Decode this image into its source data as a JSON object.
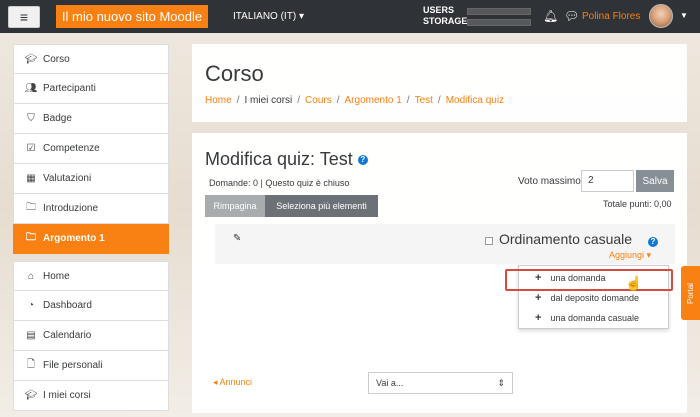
{
  "navbar": {
    "menu_icon": "hamburger-icon",
    "site_name": "Il mio nuovo sito Moodle",
    "language": "ITALIANO (IT)",
    "usage_labels": [
      "USERS",
      "STORAGE"
    ],
    "user_name": "Polina Flores",
    "accent_color": "#f98012"
  },
  "sidebar": {
    "items": [
      {
        "label": "Corso",
        "icon": "graduation-cap-icon"
      },
      {
        "label": "Partecipanti",
        "icon": "users-icon"
      },
      {
        "label": "Badge",
        "icon": "shield-icon"
      },
      {
        "label": "Competenze",
        "icon": "checkbox-icon"
      },
      {
        "label": "Valutazioni",
        "icon": "table-icon"
      },
      {
        "label": "Introduzione",
        "icon": "folder-icon"
      },
      {
        "label": "Argomento 1",
        "icon": "folder-icon"
      }
    ],
    "items2": [
      {
        "label": "Home",
        "icon": "home-icon"
      },
      {
        "label": "Dashboard",
        "icon": "dashboard-icon"
      },
      {
        "label": "Calendario",
        "icon": "calendar-icon"
      },
      {
        "label": "File personali",
        "icon": "file-icon"
      },
      {
        "label": "I miei corsi",
        "icon": "graduation-cap-icon"
      }
    ]
  },
  "header": {
    "title": "Corso",
    "breadcrumb": [
      "Home",
      "I miei corsi",
      "Cours",
      "Argomento 1",
      "Test",
      "Modifica quiz"
    ]
  },
  "quiz": {
    "title": "Modifica quiz: Test",
    "info": "Domande: 0 | Questo quiz è chiuso",
    "max_grade_label": "Voto massimo",
    "max_grade_value": "2",
    "save_label": "Salva",
    "total_points": "Totale punti: 0,00",
    "repaginate_label": "Rimpagina",
    "select_multiple_label": "Seleziona più elementi",
    "section_title": "Ordinamento casuale",
    "add_label": "Aggiungi",
    "add_menu": [
      "una domanda",
      "dal deposito domande",
      "una domanda casuale"
    ],
    "prev_link": "Annunci",
    "jump_label": "Vai a...",
    "portal_label": "Portal"
  }
}
